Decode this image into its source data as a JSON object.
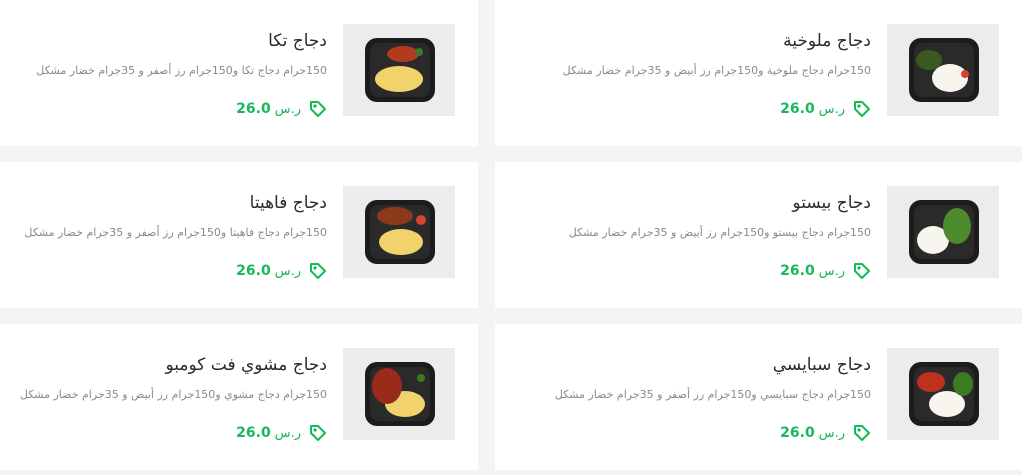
{
  "accent_color": "#16b85a",
  "currency": "ر.س",
  "items": [
    {
      "title": "دجاج ملوخية",
      "description": "150جرام دجاج ملوخية و150جرام رز أبيض و 35جرام خضار مشكل",
      "price": "26.0",
      "image_icon": "meal-container-rice-greens"
    },
    {
      "title": "دجاج تكا",
      "description": "150جرام دجاج تكا و150جرام رز أصفر و 35جرام خضار مشكل",
      "price": "26.0",
      "image_icon": "meal-container-yellow-rice"
    },
    {
      "title": "دجاج بيستو",
      "description": "150جرام دجاج بيستو و150جرام رز أبيض و 35جرام خضار مشكل",
      "price": "26.0",
      "image_icon": "meal-container-rice-greens"
    },
    {
      "title": "دجاج فاهيتا",
      "description": "150جرام دجاج فاهيتا و150جرام رز أصفر و 35جرام خضار مشكل",
      "price": "26.0",
      "image_icon": "meal-container-yellow-rice"
    },
    {
      "title": "دجاج سبايسي",
      "description": "150جرام دجاج سبايسي و150جرام رز أصفر و 35جرام خضار مشكل",
      "price": "26.0",
      "image_icon": "meal-container-rice-greens"
    },
    {
      "title": "دجاج مشوي فت كومبو",
      "description": "150جرام دجاج مشوي و150جرام رز أبيض و 35جرام خضار مشكل",
      "price": "26.0",
      "image_icon": "meal-container-yellow-rice"
    }
  ]
}
